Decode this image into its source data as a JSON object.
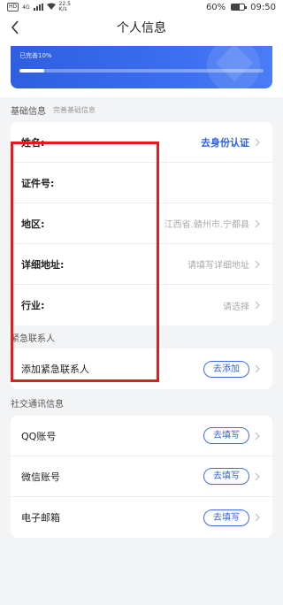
{
  "status_bar": {
    "hd_badge": "HD",
    "network": "4G",
    "speed": "22.5",
    "speed_unit": "K/s",
    "battery_percent": "60%",
    "battery_level": 0.6,
    "time": "09:50"
  },
  "nav": {
    "title": "个人信息"
  },
  "progress": {
    "label": "已完善10%",
    "value": 0.1
  },
  "basic_info": {
    "title": "基础信息",
    "subtitle": "完善基础信息",
    "rows": [
      {
        "label": "姓名:",
        "value": "去身份认证"
      },
      {
        "label": "证件号:",
        "value": ""
      },
      {
        "label": "地区:",
        "value": "江西省.赣州市.宁都县"
      },
      {
        "label": "详细地址:",
        "value": "请填写详细地址"
      },
      {
        "label": "行业:",
        "value": "请选择"
      }
    ],
    "emergency_title": "紧急联系人"
  },
  "emergency": {
    "row_label": "添加紧急联系人",
    "button": "去添加"
  },
  "social": {
    "title": "社交通讯信息",
    "rows": [
      {
        "label": "QQ账号",
        "button": "去填写"
      },
      {
        "label": "微信账号",
        "button": "去填写"
      },
      {
        "label": "电子邮箱",
        "button": "去填写"
      }
    ]
  },
  "colors": {
    "accent": "#2f5fe0",
    "highlight": "#e21b1b"
  }
}
